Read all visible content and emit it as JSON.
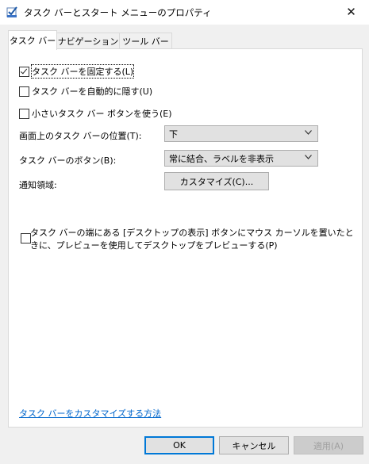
{
  "window": {
    "title": "タスク バーとスタート メニューのプロパティ",
    "close_glyph": "✕"
  },
  "tabs": [
    {
      "label": "タスク バー",
      "active": true
    },
    {
      "label": "ナビゲーション",
      "active": false
    },
    {
      "label": "ツール バー",
      "active": false
    }
  ],
  "taskbar": {
    "lock": {
      "label": "タスク バーを固定する(L)",
      "checked": true
    },
    "autohide": {
      "label": "タスク バーを自動的に隠す(U)",
      "checked": false
    },
    "small_buttons": {
      "label": "小さいタスク バー ボタンを使う(E)",
      "checked": false
    },
    "position": {
      "label": "画面上のタスク バーの位置(T):",
      "value": "下"
    },
    "buttons": {
      "label": "タスク バーのボタン(B):",
      "value": "常に結合、ラベルを非表示"
    },
    "notification_area": {
      "label": "通知領域:",
      "button": "カスタマイズ(C)..."
    },
    "peek": {
      "label": "タスク バーの端にある [デスクトップの表示] ボタンにマウス カーソルを置いたときに、プレビューを使用してデスクトップをプレビューする(P)",
      "checked": false
    },
    "help_link": "タスク バーをカスタマイズする方法"
  },
  "footer": {
    "ok": "OK",
    "cancel": "キャンセル",
    "apply": "適用(A)"
  }
}
